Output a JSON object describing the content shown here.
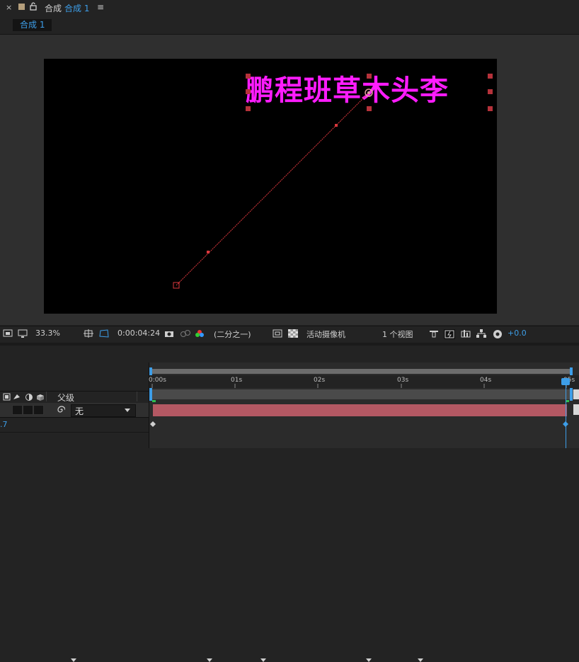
{
  "panel": {
    "close_glyph": "×",
    "lock_icon": "lock-open-icon",
    "title_prefix": "合成",
    "comp_name": "合成 1",
    "menu_glyph": "≡",
    "tab_label": "合成 1"
  },
  "canvas_text": "鹏程班草木头李",
  "toolbar": {
    "zoom": "33.3%",
    "timecode": "0:00:04:24",
    "resolution": "(二分之一)",
    "camera": "活动摄像机",
    "views": "1 个视图",
    "exposure": "+0.0"
  },
  "timeline": {
    "ruler_labels": [
      "0:00s",
      "01s",
      "02s",
      "03s",
      "04s",
      "05s"
    ],
    "parent_header": "父级",
    "parent_value": "无",
    "prop_value_fragment": ".7"
  },
  "colors": {
    "text_magenta": "#ff1cff",
    "accent_blue": "#3d9ee8",
    "layer_bar": "#b45863",
    "motion_path": "#d9373c"
  }
}
